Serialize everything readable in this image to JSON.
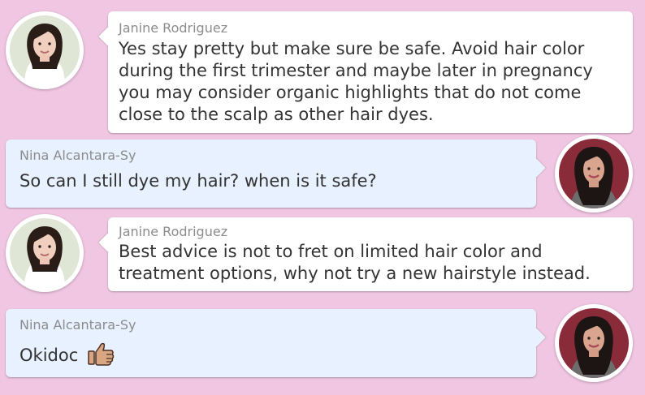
{
  "colors": {
    "background": "#f1c6e3",
    "incoming_bubble": "#ffffff",
    "outgoing_bubble": "#e7f1ff",
    "sender_text": "#8c8c8c",
    "message_text": "#333333"
  },
  "messages": [
    {
      "sender": "Janine Rodriguez",
      "lines": [
        "Yes stay pretty but make sure be safe.  Avoid hair color",
        "during the first trimester and maybe later in pregnancy",
        "you may consider organic highlights that do not come",
        "close to the scalp as other hair dyes."
      ],
      "avatar_icon": "janine-avatar-photo"
    },
    {
      "sender": "Nina Alcantara-Sy",
      "lines": [
        "So can I still dye my hair? when is it safe?"
      ],
      "avatar_icon": "nina-avatar-photo"
    },
    {
      "sender": "Janine Rodriguez",
      "lines": [
        "Best advice is not to fret on limited hair color and",
        "treatment options, why not try a new hairstyle instead."
      ],
      "avatar_icon": "janine-avatar-photo"
    },
    {
      "sender": "Nina Alcantara-Sy",
      "lines": [
        "Okidoc"
      ],
      "emoji_icon": "thumbs-up-icon",
      "avatar_icon": "nina-avatar-photo"
    }
  ]
}
